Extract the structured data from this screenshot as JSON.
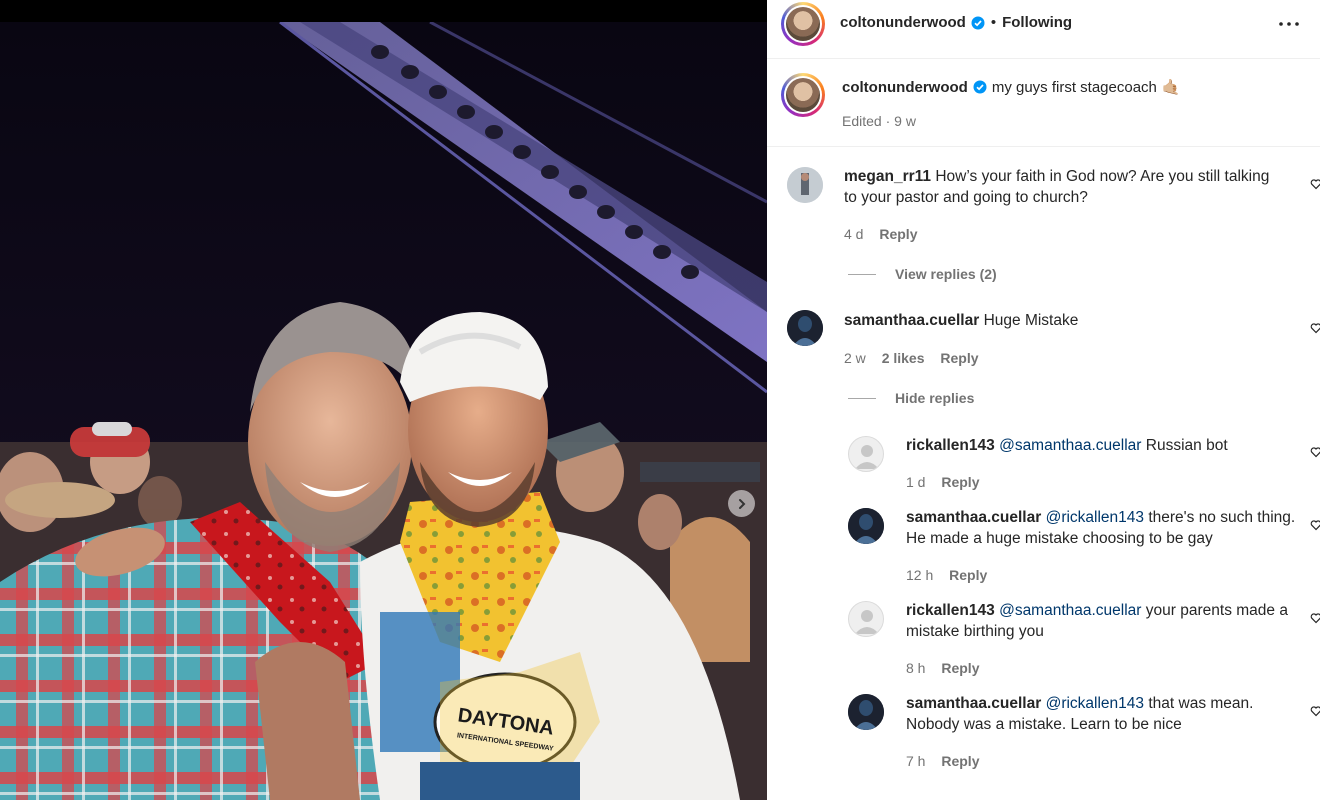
{
  "post": {
    "author": "coltonunderwood",
    "follow_state": "Following",
    "separator": "•",
    "caption": "my guys first stagecoach",
    "caption_emoji": "🤙🏼",
    "edited_label": "Edited",
    "age": "9 w",
    "meta_dot": "·"
  },
  "photo": {
    "shirt_print": "DAYTONA",
    "shirt_sub": "INTERNATIONAL SPEEDWAY"
  },
  "comments": [
    {
      "user": "megan_rr11",
      "text": "How’s your faith in God now? Are you still talking to your pastor and going to church?",
      "age": "4 d",
      "likes": "",
      "reply_label": "Reply",
      "replies_toggle": "View replies (2)"
    },
    {
      "user": "samanthaa.cuellar",
      "text": "Huge Mistake",
      "age": "2 w",
      "likes": "2 likes",
      "reply_label": "Reply",
      "replies_toggle": "Hide replies"
    }
  ],
  "replies": [
    {
      "user": "rickallen143",
      "mention": "@samanthaa.cuellar",
      "text": "Russian bot",
      "age": "1 d",
      "reply_label": "Reply"
    },
    {
      "user": "samanthaa.cuellar",
      "mention": "@rickallen143",
      "text": "there's no such thing. He made a huge mistake choosing to be gay",
      "age": "12 h",
      "reply_label": "Reply"
    },
    {
      "user": "rickallen143",
      "mention": "@samanthaa.cuellar",
      "text": "your parents made a mistake birthing you",
      "age": "8 h",
      "reply_label": "Reply"
    },
    {
      "user": "samanthaa.cuellar",
      "mention": "@rickallen143",
      "text": "that was mean. Nobody was a mistake. Learn to be nice",
      "age": "7 h",
      "reply_label": "Reply"
    }
  ],
  "icons": {
    "verified": "verified-badge-icon",
    "more": "more-options-icon",
    "next": "chevron-right-icon",
    "heart": "heart-outline-icon"
  },
  "colors": {
    "verified_blue": "#0095f6",
    "mention_blue": "#00376b",
    "muted": "#737373"
  }
}
